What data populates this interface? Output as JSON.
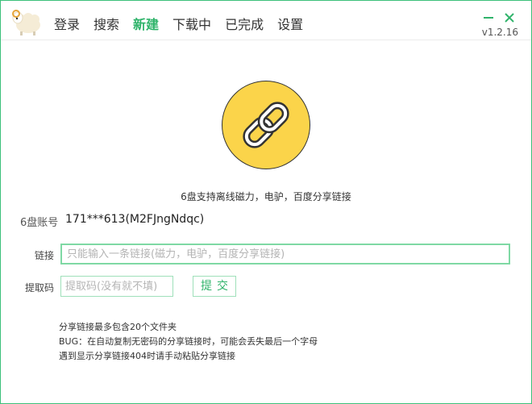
{
  "app": {
    "version": "v1.2.16",
    "accent_color": "#2fb36a",
    "logo_icon": "sheep-icon"
  },
  "nav": {
    "items": [
      {
        "label": "登录"
      },
      {
        "label": "搜索"
      },
      {
        "label": "新建",
        "active": true
      },
      {
        "label": "下载中"
      },
      {
        "label": "已完成"
      },
      {
        "label": "设置"
      }
    ]
  },
  "window_controls": {
    "minimize_icon": "minimize-icon",
    "close_icon": "close-icon"
  },
  "hero": {
    "icon": "link-chain-icon",
    "circle_color": "#fbd44a",
    "tagline": "6盘支持离线磁力，电驴，百度分享链接"
  },
  "account": {
    "label": "6盘账号",
    "value": "171***613(M2FJngNdqc)"
  },
  "form": {
    "link_label": "链接",
    "link_placeholder": "只能输入一条链接(磁力，电驴，百度分享链接)",
    "link_value": "",
    "code_label": "提取码",
    "code_placeholder": "提取码(没有就不填)",
    "code_value": "",
    "submit_label": "提交"
  },
  "notes": [
    "分享链接最多包含20个文件夹",
    "BUG：在自动复制无密码的分享链接时，可能会丢失最后一个字母",
    "遇到显示分享链接404时请手动粘贴分享链接"
  ]
}
